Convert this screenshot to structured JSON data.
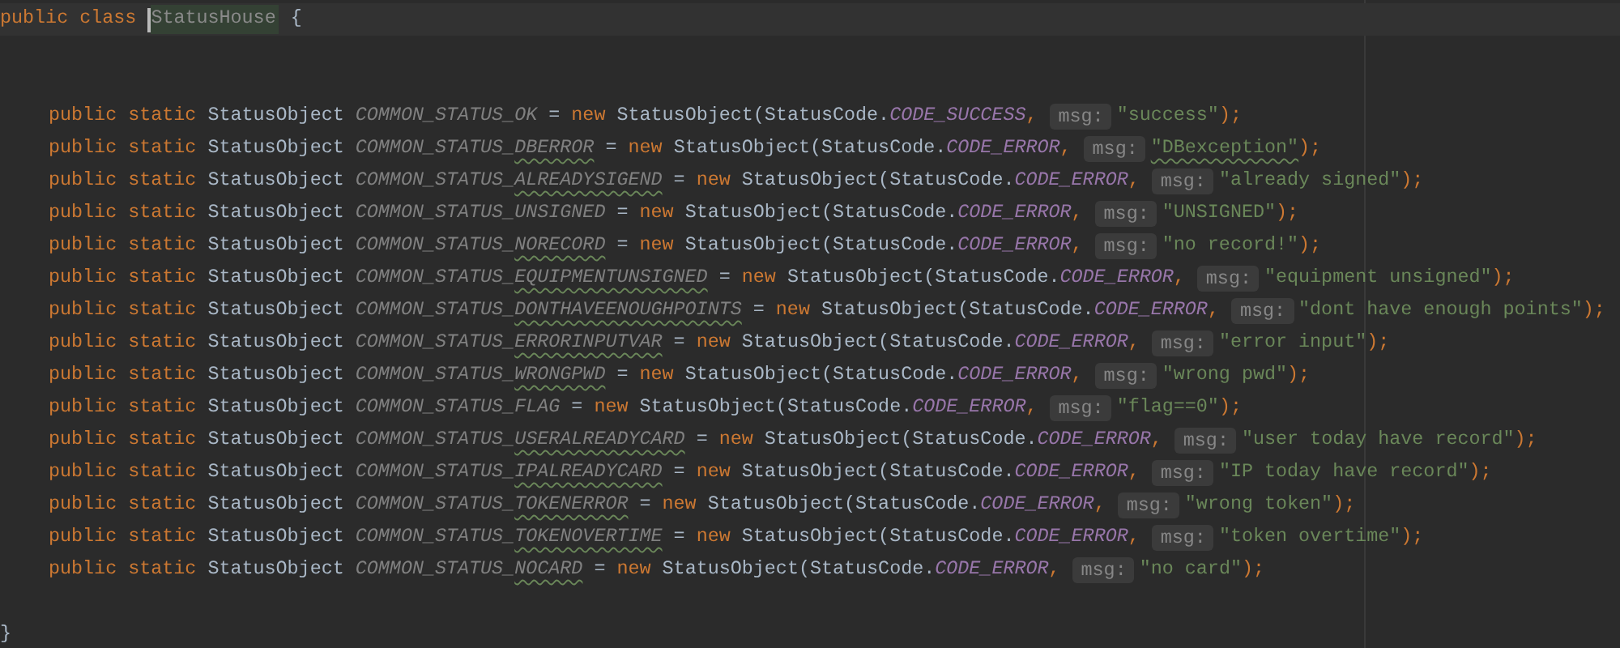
{
  "editor": {
    "class_header": {
      "modifiers": "public class",
      "name": "StatusHouse",
      "brace": "{",
      "current_line": true
    },
    "fields": [
      {
        "modifiers": "public static",
        "type": "StatusObject",
        "name_prefix": "COMMON_STATUS_",
        "name_word": "OK",
        "name_typo": false,
        "op": "=",
        "keyword": "new",
        "call": "StatusObject(StatusCode.",
        "constant": "CODE_SUCCESS",
        "comma": ",",
        "hint": "msg:",
        "message": "\"success\"",
        "message_typo": false,
        "end": ");"
      },
      {
        "modifiers": "public static",
        "type": "StatusObject",
        "name_prefix": "COMMON_STATUS_",
        "name_word": "DBERROR",
        "name_typo": true,
        "op": "=",
        "keyword": "new",
        "call": "StatusObject(StatusCode.",
        "constant": "CODE_ERROR",
        "comma": ",",
        "hint": "msg:",
        "message": "\"DBexception\"",
        "message_typo": true,
        "end": ");"
      },
      {
        "modifiers": "public static",
        "type": "StatusObject",
        "name_prefix": "COMMON_STATUS_",
        "name_word": "ALREADYSIGEND",
        "name_typo": true,
        "op": "=",
        "keyword": "new",
        "call": "StatusObject(StatusCode.",
        "constant": "CODE_ERROR",
        "comma": ",",
        "hint": "msg:",
        "message": "\"already signed\"",
        "message_typo": false,
        "end": ");"
      },
      {
        "modifiers": "public static",
        "type": "StatusObject",
        "name_prefix": "COMMON_STATUS_",
        "name_word": "UNSIGNED",
        "name_typo": false,
        "op": "=",
        "keyword": "new",
        "call": "StatusObject(StatusCode.",
        "constant": "CODE_ERROR",
        "comma": ",",
        "hint": "msg:",
        "message": "\"UNSIGNED\"",
        "message_typo": false,
        "end": ");"
      },
      {
        "modifiers": "public static",
        "type": "StatusObject",
        "name_prefix": "COMMON_STATUS_",
        "name_word": "NORECORD",
        "name_typo": true,
        "op": "=",
        "keyword": "new",
        "call": "StatusObject(StatusCode.",
        "constant": "CODE_ERROR",
        "comma": ",",
        "hint": "msg:",
        "message": "\"no record!\"",
        "message_typo": false,
        "end": ");"
      },
      {
        "modifiers": "public static",
        "type": "StatusObject",
        "name_prefix": "COMMON_STATUS_",
        "name_word": "EQUIPMENTUNSIGNED",
        "name_typo": true,
        "op": "=",
        "keyword": "new",
        "call": "StatusObject(StatusCode.",
        "constant": "CODE_ERROR",
        "comma": ",",
        "hint": "msg:",
        "message": "\"equipment unsigned\"",
        "message_typo": false,
        "end": ");"
      },
      {
        "modifiers": "public static",
        "type": "StatusObject",
        "name_prefix": "COMMON_STATUS_",
        "name_word": "DONTHAVEENOUGHPOINTS",
        "name_typo": true,
        "op": "=",
        "keyword": "new",
        "call": "StatusObject(StatusCode.",
        "constant": "CODE_ERROR",
        "comma": ",",
        "hint": "msg:",
        "message": "\"dont have enough points\"",
        "message_typo": false,
        "end": ");"
      },
      {
        "modifiers": "public static",
        "type": "StatusObject",
        "name_prefix": "COMMON_STATUS_",
        "name_word": "ERRORINPUTVAR",
        "name_typo": true,
        "op": "=",
        "keyword": "new",
        "call": "StatusObject(StatusCode.",
        "constant": "CODE_ERROR",
        "comma": ",",
        "hint": "msg:",
        "message": "\"error input\"",
        "message_typo": false,
        "end": ");"
      },
      {
        "modifiers": "public static",
        "type": "StatusObject",
        "name_prefix": "COMMON_STATUS_",
        "name_word": "WRONGPWD",
        "name_typo": true,
        "op": "=",
        "keyword": "new",
        "call": "StatusObject(StatusCode.",
        "constant": "CODE_ERROR",
        "comma": ",",
        "hint": "msg:",
        "message": "\"wrong pwd\"",
        "message_typo": false,
        "end": ");"
      },
      {
        "modifiers": "public static",
        "type": "StatusObject",
        "name_prefix": "COMMON_STATUS_",
        "name_word": "FLAG",
        "name_typo": false,
        "op": "=",
        "keyword": "new",
        "call": "StatusObject(StatusCode.",
        "constant": "CODE_ERROR",
        "comma": ",",
        "hint": "msg:",
        "message": "\"flag==0\"",
        "message_typo": false,
        "end": ");"
      },
      {
        "modifiers": "public static",
        "type": "StatusObject",
        "name_prefix": "COMMON_STATUS_",
        "name_word": "USERALREADYCARD",
        "name_typo": true,
        "op": "=",
        "keyword": "new",
        "call": "StatusObject(StatusCode.",
        "constant": "CODE_ERROR",
        "comma": ",",
        "hint": "msg:",
        "message": "\"user today have record\"",
        "message_typo": false,
        "end": ");"
      },
      {
        "modifiers": "public static",
        "type": "StatusObject",
        "name_prefix": "COMMON_STATUS_",
        "name_word": "IPALREADYCARD",
        "name_typo": true,
        "op": "=",
        "keyword": "new",
        "call": "StatusObject(StatusCode.",
        "constant": "CODE_ERROR",
        "comma": ",",
        "hint": "msg:",
        "message": "\"IP today have record\"",
        "message_typo": false,
        "end": ");"
      },
      {
        "modifiers": "public static",
        "type": "StatusObject",
        "name_prefix": "COMMON_STATUS_",
        "name_word": "TOKENERROR",
        "name_typo": true,
        "op": "=",
        "keyword": "new",
        "call": "StatusObject(StatusCode.",
        "constant": "CODE_ERROR",
        "comma": ",",
        "hint": "msg:",
        "message": "\"wrong token\"",
        "message_typo": false,
        "end": ");"
      },
      {
        "modifiers": "public static",
        "type": "StatusObject",
        "name_prefix": "COMMON_STATUS_",
        "name_word": "TOKENOVERTIME",
        "name_typo": true,
        "op": "=",
        "keyword": "new",
        "call": "StatusObject(StatusCode.",
        "constant": "CODE_ERROR",
        "comma": ",",
        "hint": "msg:",
        "message": "\"token overtime\"",
        "message_typo": false,
        "end": ");"
      },
      {
        "modifiers": "public static",
        "type": "StatusObject",
        "name_prefix": "COMMON_STATUS_",
        "name_word": "NOCARD",
        "name_typo": true,
        "op": "=",
        "keyword": "new",
        "call": "StatusObject(StatusCode.",
        "constant": "CODE_ERROR",
        "comma": ",",
        "hint": "msg:",
        "message": "\"no card\"",
        "message_typo": false,
        "end": ");"
      }
    ],
    "closing_brace": "}"
  }
}
